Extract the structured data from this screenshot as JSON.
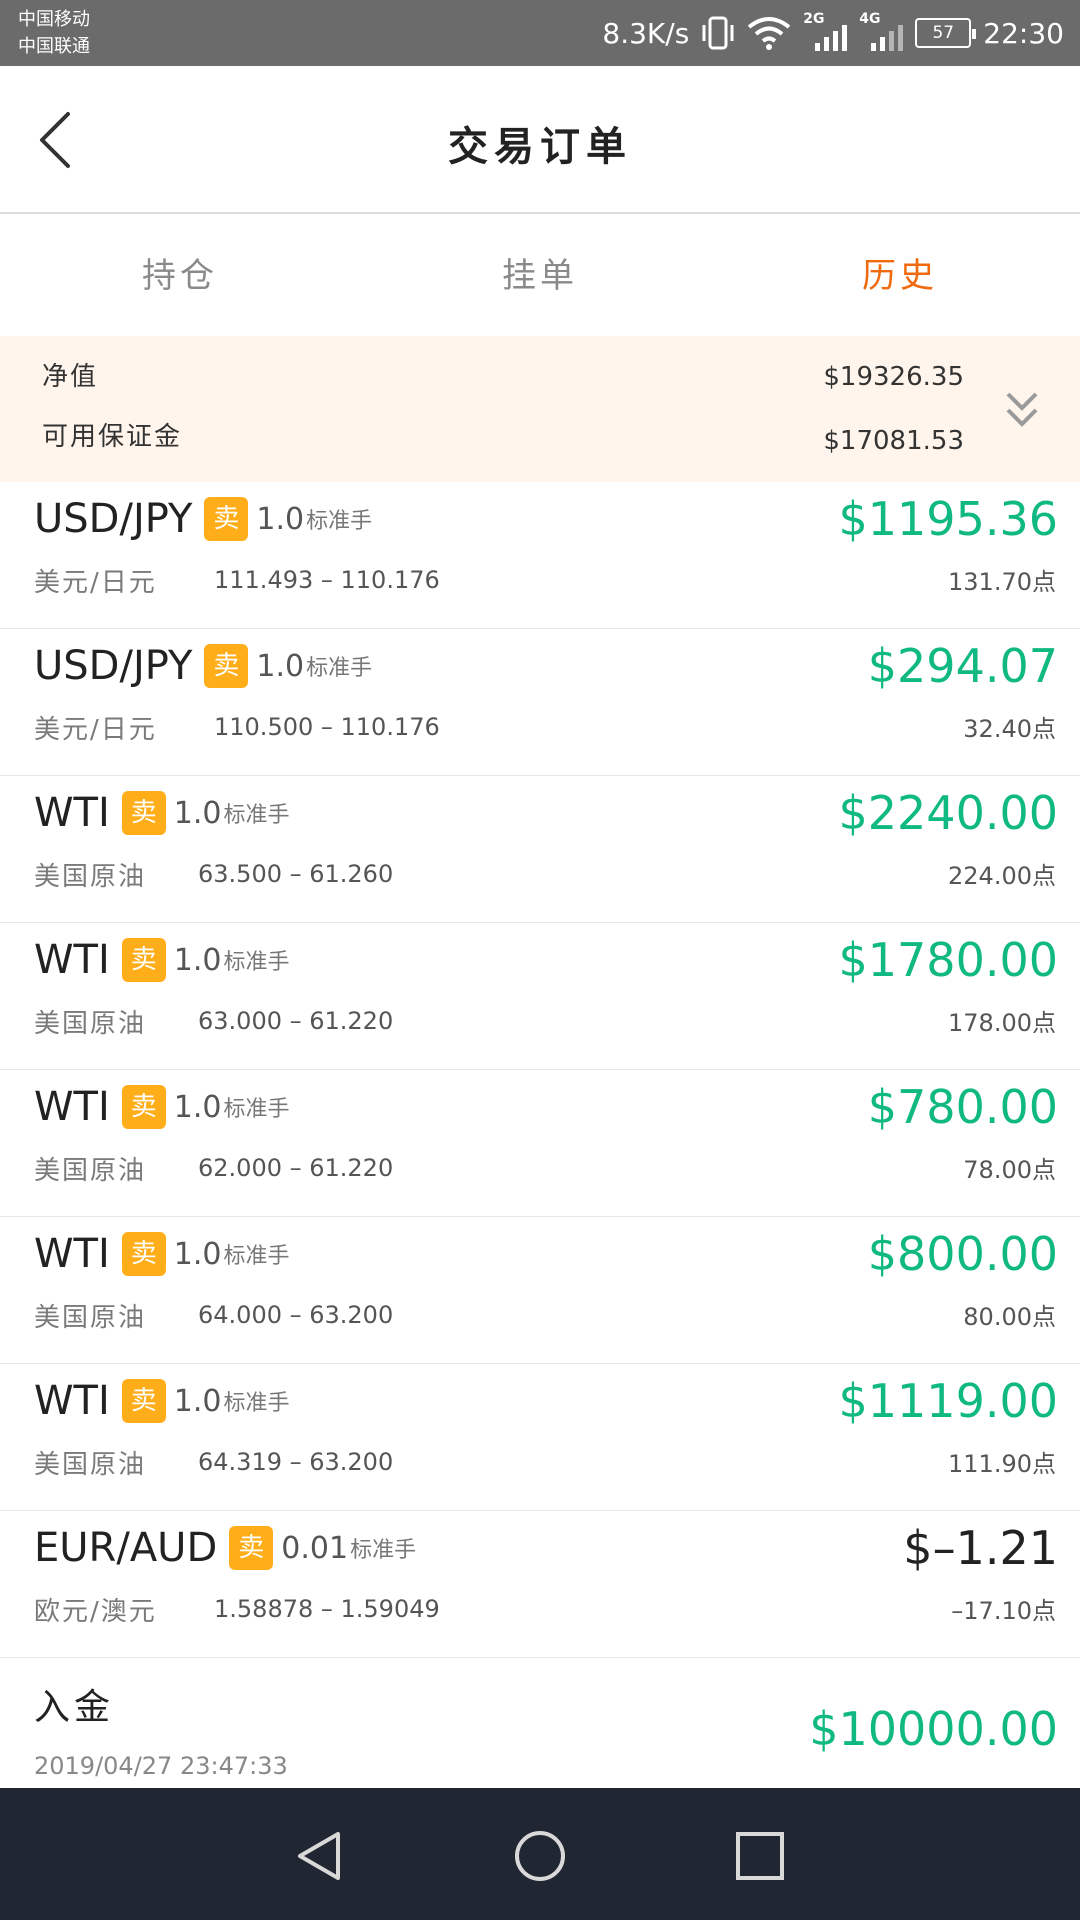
{
  "status_bar": {
    "carrier1": "中国移动",
    "carrier2": "中国联通",
    "speed": "8.3K/s",
    "sig1_tag": "2G",
    "sig2_tag": "4G",
    "battery": "57",
    "time": "22:30"
  },
  "header": {
    "title": "交易订单"
  },
  "tabs": [
    {
      "label": "持仓",
      "active": false
    },
    {
      "label": "挂单",
      "active": false
    },
    {
      "label": "历史",
      "active": true
    }
  ],
  "summary": {
    "net_label": "净值",
    "net_value": "$19326.35",
    "margin_label": "可用保证金",
    "margin_value": "$17081.53"
  },
  "orders": [
    {
      "symbol": "USD/JPY",
      "side": "卖",
      "lots": "1.0",
      "unit": "标准手",
      "name": "美元/日元",
      "range": "111.493 – 110.176",
      "amount": "$1195.36",
      "points": "131.70点",
      "negative": false
    },
    {
      "symbol": "USD/JPY",
      "side": "卖",
      "lots": "1.0",
      "unit": "标准手",
      "name": "美元/日元",
      "range": "110.500 – 110.176",
      "amount": "$294.07",
      "points": "32.40点",
      "negative": false
    },
    {
      "symbol": "WTI",
      "side": "卖",
      "lots": "1.0",
      "unit": "标准手",
      "name": "美国原油",
      "range": "63.500 – 61.260",
      "amount": "$2240.00",
      "points": "224.00点",
      "negative": false
    },
    {
      "symbol": "WTI",
      "side": "卖",
      "lots": "1.0",
      "unit": "标准手",
      "name": "美国原油",
      "range": "63.000 – 61.220",
      "amount": "$1780.00",
      "points": "178.00点",
      "negative": false
    },
    {
      "symbol": "WTI",
      "side": "卖",
      "lots": "1.0",
      "unit": "标准手",
      "name": "美国原油",
      "range": "62.000 – 61.220",
      "amount": "$780.00",
      "points": "78.00点",
      "negative": false
    },
    {
      "symbol": "WTI",
      "side": "卖",
      "lots": "1.0",
      "unit": "标准手",
      "name": "美国原油",
      "range": "64.000 – 63.200",
      "amount": "$800.00",
      "points": "80.00点",
      "negative": false
    },
    {
      "symbol": "WTI",
      "side": "卖",
      "lots": "1.0",
      "unit": "标准手",
      "name": "美国原油",
      "range": "64.319 – 63.200",
      "amount": "$1119.00",
      "points": "111.90点",
      "negative": false
    },
    {
      "symbol": "EUR/AUD",
      "side": "卖",
      "lots": "0.01",
      "unit": "标准手",
      "name": "欧元/澳元",
      "range": "1.58878 – 1.59049",
      "amount": "$–1.21",
      "points": "–17.10点",
      "negative": true
    }
  ],
  "deposit": {
    "label": "入金",
    "time": "2019/04/27 23:47:33",
    "amount": "$10000.00"
  },
  "colors": {
    "profit": "#10b882",
    "accent": "#f06a10",
    "badge": "#ffae1a"
  },
  "icons": {
    "back": "chevron-left-icon",
    "expand": "double-chevron-down-icon",
    "nav": [
      "triangle-back-icon",
      "circle-home-icon",
      "square-recent-icon"
    ]
  }
}
